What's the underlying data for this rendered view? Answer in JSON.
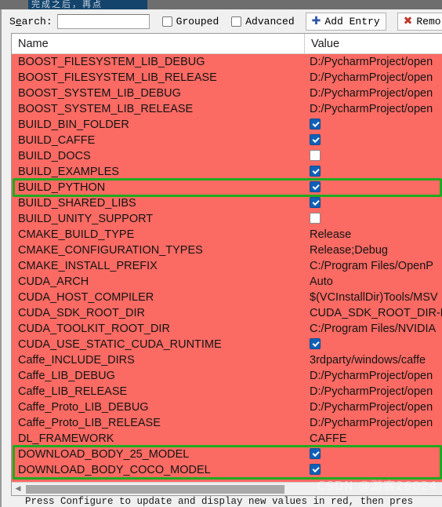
{
  "backdrop": {
    "title_fragment": "完成之后，再点"
  },
  "toolbar": {
    "search_label_pre": "S",
    "search_label_mnemonic": "e",
    "search_label_post": "arch:",
    "search_value": "",
    "search_placeholder": "",
    "grouped_label": "Grouped",
    "grouped_checked": false,
    "advanced_label": "Advanced",
    "advanced_checked": false,
    "add_entry_label": "Add Entry",
    "add_entry_icon": "plus-icon",
    "remove_entry_label": "Remo",
    "remove_entry_icon": "x-icon"
  },
  "table": {
    "columns": [
      "Name",
      "Value"
    ],
    "rows": [
      {
        "name": "BOOST_FILESYSTEM_LIB_DEBUG",
        "type": "text",
        "value": "D:/PycharmProject/open"
      },
      {
        "name": "BOOST_FILESYSTEM_LIB_RELEASE",
        "type": "text",
        "value": "D:/PycharmProject/open"
      },
      {
        "name": "BOOST_SYSTEM_LIB_DEBUG",
        "type": "text",
        "value": "D:/PycharmProject/open"
      },
      {
        "name": "BOOST_SYSTEM_LIB_RELEASE",
        "type": "text",
        "value": "D:/PycharmProject/open"
      },
      {
        "name": "BUILD_BIN_FOLDER",
        "type": "checkbox",
        "value": true
      },
      {
        "name": "BUILD_CAFFE",
        "type": "checkbox",
        "value": true
      },
      {
        "name": "BUILD_DOCS",
        "type": "checkbox",
        "value": false
      },
      {
        "name": "BUILD_EXAMPLES",
        "type": "checkbox",
        "value": true
      },
      {
        "name": "BUILD_PYTHON",
        "type": "checkbox",
        "value": true
      },
      {
        "name": "BUILD_SHARED_LIBS",
        "type": "checkbox",
        "value": true
      },
      {
        "name": "BUILD_UNITY_SUPPORT",
        "type": "checkbox",
        "value": false
      },
      {
        "name": "CMAKE_BUILD_TYPE",
        "type": "text",
        "value": "Release"
      },
      {
        "name": "CMAKE_CONFIGURATION_TYPES",
        "type": "text",
        "value": "Release;Debug"
      },
      {
        "name": "CMAKE_INSTALL_PREFIX",
        "type": "text",
        "value": "C:/Program Files/OpenP"
      },
      {
        "name": "CUDA_ARCH",
        "type": "text",
        "value": "Auto"
      },
      {
        "name": "CUDA_HOST_COMPILER",
        "type": "text",
        "value": "$(VCInstallDir)Tools/MSV"
      },
      {
        "name": "CUDA_SDK_ROOT_DIR",
        "type": "text",
        "value": "CUDA_SDK_ROOT_DIR-N"
      },
      {
        "name": "CUDA_TOOLKIT_ROOT_DIR",
        "type": "text",
        "value": "C:/Program Files/NVIDIA"
      },
      {
        "name": "CUDA_USE_STATIC_CUDA_RUNTIME",
        "type": "checkbox",
        "value": true
      },
      {
        "name": "Caffe_INCLUDE_DIRS",
        "type": "text",
        "value": "3rdparty/windows/caffe"
      },
      {
        "name": "Caffe_LIB_DEBUG",
        "type": "text",
        "value": "D:/PycharmProject/open"
      },
      {
        "name": "Caffe_LIB_RELEASE",
        "type": "text",
        "value": "D:/PycharmProject/open"
      },
      {
        "name": "Caffe_Proto_LIB_DEBUG",
        "type": "text",
        "value": "D:/PycharmProject/open"
      },
      {
        "name": "Caffe_Proto_LIB_RELEASE",
        "type": "text",
        "value": "D:/PycharmProject/open"
      },
      {
        "name": "DL_FRAMEWORK",
        "type": "text",
        "value": "CAFFE"
      },
      {
        "name": "DOWNLOAD_BODY_25_MODEL",
        "type": "checkbox",
        "value": true
      },
      {
        "name": "DOWNLOAD_BODY_COCO_MODEL",
        "type": "checkbox",
        "value": true
      }
    ]
  },
  "annotations": {
    "color": "#1faa1f",
    "boxes": [
      {
        "label": "build-python-highlight",
        "row_start": 8,
        "row_end": 8
      },
      {
        "label": "download-models-highlight",
        "row_start": 25,
        "row_end": 26
      }
    ]
  },
  "status": {
    "text": "Press Configure to update and display new values in red, then pres"
  },
  "watermark": {
    "text": "CSDN @游客26024"
  }
}
